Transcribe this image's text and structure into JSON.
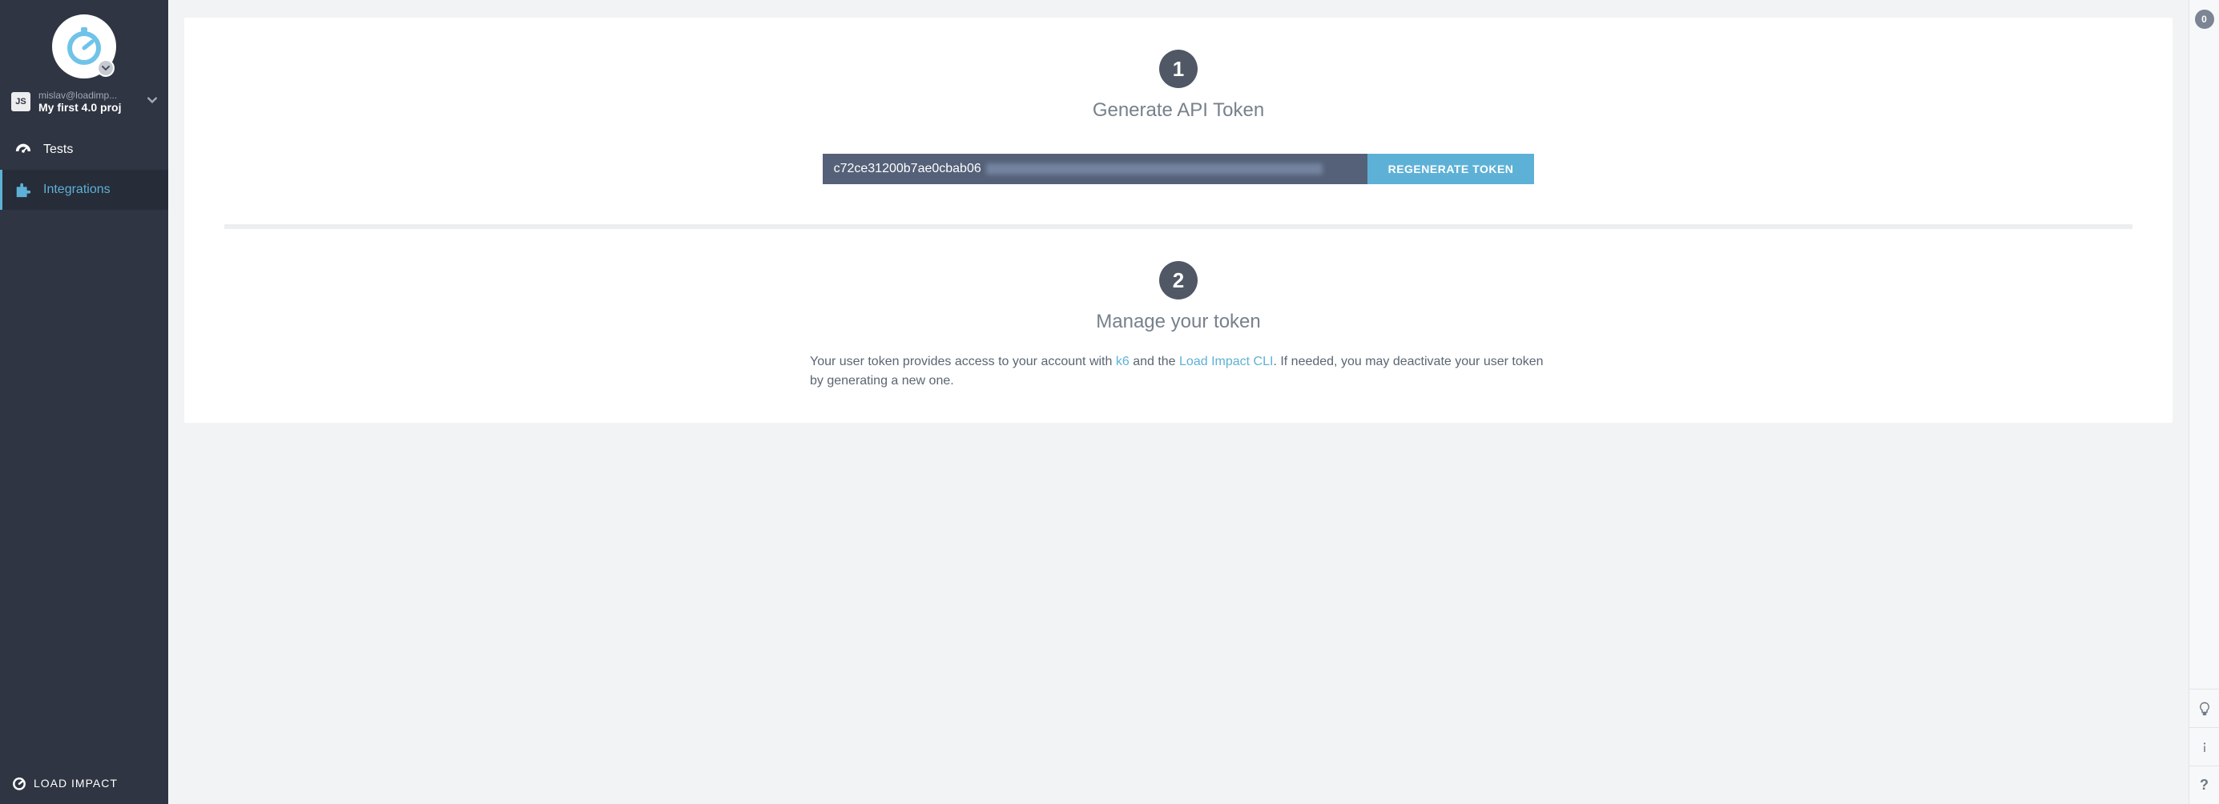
{
  "sidebar": {
    "user_email": "mislav@loadimp...",
    "project_name": "My first 4.0 proj",
    "nav": [
      {
        "label": "Tests"
      },
      {
        "label": "Integrations"
      }
    ],
    "brand": "LOAD IMPACT"
  },
  "main": {
    "step1": {
      "number": "1",
      "title": "Generate API Token",
      "token_visible": "c72ce31200b7ae0cbab06",
      "regenerate_label": "REGENERATE TOKEN"
    },
    "step2": {
      "number": "2",
      "title": "Manage your token",
      "desc_part1": "Your user token provides access to your account with ",
      "link_k6": "k6",
      "desc_part2": " and the ",
      "link_cli": "Load Impact CLI",
      "desc_part3": ". If needed, you may deactivate your user token by generating a new one."
    }
  },
  "util": {
    "notification_count": "0"
  }
}
